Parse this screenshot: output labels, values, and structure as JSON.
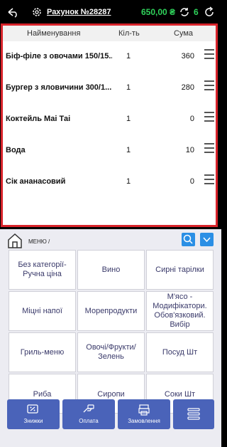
{
  "topbar": {
    "title": "Рахунок №28287",
    "total": "650,00 ₴",
    "guests": "6"
  },
  "order": {
    "columns": {
      "name": "Найменування",
      "qty": "Кіл-ть",
      "sum": "Сума"
    },
    "items": [
      {
        "name": "Біф-філе з овочами 150/15...",
        "qty": "1",
        "sum": "360"
      },
      {
        "name": "Бургер з яловичини 300/1...",
        "qty": "1",
        "sum": "280"
      },
      {
        "name": "Коктейль Маі Таі",
        "qty": "1",
        "sum": "0"
      },
      {
        "name": "Вода",
        "qty": "1",
        "sum": "10"
      },
      {
        "name": "Сік ананасовий",
        "qty": "1",
        "sum": "0"
      }
    ]
  },
  "menu": {
    "breadcrumb": "МЕНЮ",
    "separator": "/",
    "categories": [
      "Без категорії-Ручна ціна",
      "Вино",
      "Сирні тарілки",
      "Міцні напої",
      "Морепродукти",
      "М'ясо - Модифікатори. Обов'язковий. Вибір",
      "Гриль-меню",
      "Овочі/Фрукти/Зелень",
      "Посуд Шт",
      "Риба",
      "Сиропи",
      "Соки Шт"
    ]
  },
  "actions": {
    "discounts": "Знижки",
    "payment": "Оплата",
    "orders": "Замовлення"
  },
  "colors": {
    "accent": "#4a63b9",
    "highlight": "#d8242b",
    "total": "#2fd35b",
    "blue_button": "#2b8fe5"
  }
}
